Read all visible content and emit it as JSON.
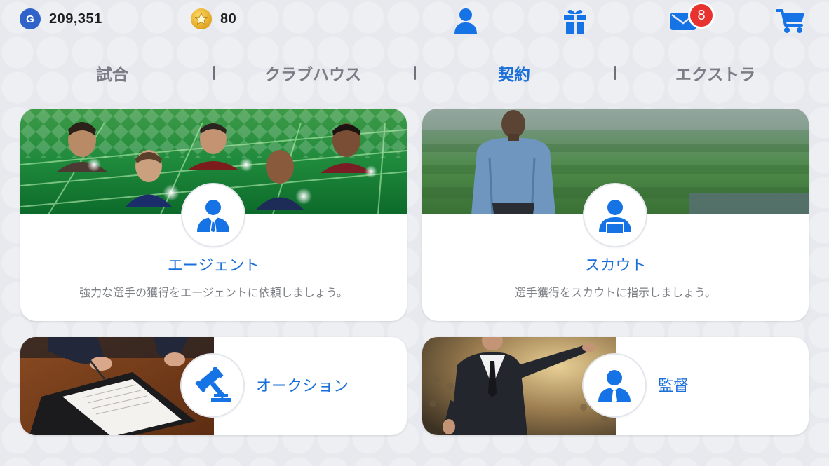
{
  "currencies": {
    "gp": {
      "value": "209,351",
      "icon": "gp-coin-icon",
      "color": "#2f63c9"
    },
    "coins": {
      "value": "80",
      "icon": "star-coin-icon",
      "color": "#e0a51e"
    }
  },
  "top_icons": {
    "profile": "user-icon",
    "gift": "gift-icon",
    "mail": "mail-icon",
    "mail_badge": "8",
    "cart": "cart-icon"
  },
  "tabs": [
    {
      "label": "試合",
      "active": false
    },
    {
      "label": "クラブハウス",
      "active": false
    },
    {
      "label": "契約",
      "active": true
    },
    {
      "label": "エクストラ",
      "active": false
    }
  ],
  "cards": {
    "agent": {
      "title": "エージェント",
      "description": "強力な選手の獲得をエージェントに依頼しましょう。",
      "icon": "agent-icon"
    },
    "scout": {
      "title": "スカウト",
      "description": "選手獲得をスカウトに指示しましょう。",
      "icon": "scout-icon"
    },
    "auction": {
      "title": "オークション",
      "icon": "gavel-icon"
    },
    "manager": {
      "title": "監督",
      "icon": "manager-icon"
    }
  },
  "colors": {
    "accent": "#1a6fd8",
    "tab_inactive": "#7a7d85",
    "badge": "#e8322f",
    "background": "#e8e9ee",
    "icon_blue": "#1673e6"
  }
}
